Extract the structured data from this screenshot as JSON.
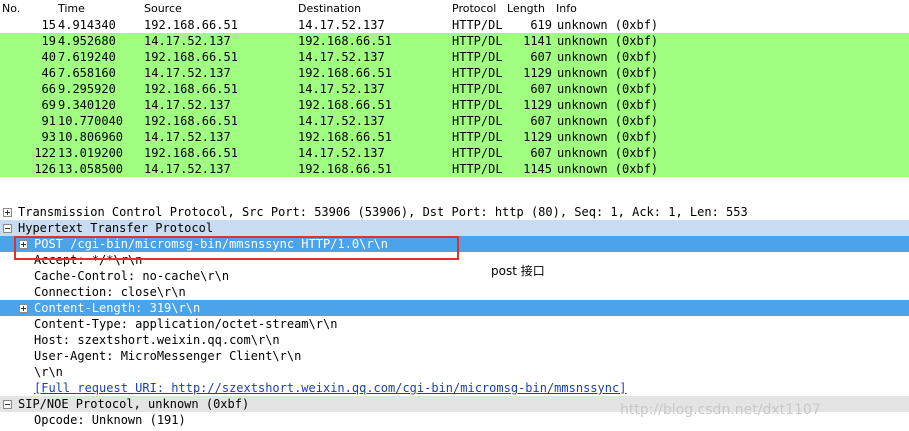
{
  "columns": {
    "no": "No.",
    "time": "Time",
    "source": "Source",
    "destination": "Destination",
    "protocol": "Protocol",
    "length": "Length",
    "info": "Info"
  },
  "packets": [
    {
      "no": "15",
      "time": "4.914340",
      "source": "192.168.66.51",
      "destination": "14.17.52.137",
      "protocol": "HTTP/DL",
      "length": "619",
      "info": "unknown (0xbf)",
      "color": "selected-white"
    },
    {
      "no": "19",
      "time": "4.952680",
      "source": "14.17.52.137",
      "destination": "192.168.66.51",
      "protocol": "HTTP/DL",
      "length": "1141",
      "info": "unknown (0xbf)",
      "color": "#a0ff80"
    },
    {
      "no": "40",
      "time": "7.619240",
      "source": "192.168.66.51",
      "destination": "14.17.52.137",
      "protocol": "HTTP/DL",
      "length": "607",
      "info": "unknown (0xbf)",
      "color": "#a0ff80"
    },
    {
      "no": "46",
      "time": "7.658160",
      "source": "14.17.52.137",
      "destination": "192.168.66.51",
      "protocol": "HTTP/DL",
      "length": "1129",
      "info": "unknown (0xbf)",
      "color": "#a0ff80"
    },
    {
      "no": "66",
      "time": "9.295920",
      "source": "192.168.66.51",
      "destination": "14.17.52.137",
      "protocol": "HTTP/DL",
      "length": "607",
      "info": "unknown (0xbf)",
      "color": "#a0ff80"
    },
    {
      "no": "69",
      "time": "9.340120",
      "source": "14.17.52.137",
      "destination": "192.168.66.51",
      "protocol": "HTTP/DL",
      "length": "1129",
      "info": "unknown (0xbf)",
      "color": "#a0ff80"
    },
    {
      "no": "91",
      "time": "10.770040",
      "source": "192.168.66.51",
      "destination": "14.17.52.137",
      "protocol": "HTTP/DL",
      "length": "607",
      "info": "unknown (0xbf)",
      "color": "#a0ff80"
    },
    {
      "no": "93",
      "time": "10.806960",
      "source": "14.17.52.137",
      "destination": "192.168.66.51",
      "protocol": "HTTP/DL",
      "length": "1129",
      "info": "unknown (0xbf)",
      "color": "#a0ff80"
    },
    {
      "no": "122",
      "time": "13.019200",
      "source": "192.168.66.51",
      "destination": "14.17.52.137",
      "protocol": "HTTP/DL",
      "length": "607",
      "info": "unknown (0xbf)",
      "color": "#a0ff80"
    },
    {
      "no": "126",
      "time": "13.058500",
      "source": "14.17.52.137",
      "destination": "192.168.66.51",
      "protocol": "HTTP/DL",
      "length": "1145",
      "info": "unknown (0xbf)",
      "color": "#a0ff80"
    }
  ],
  "details": {
    "tcp": "Transmission Control Protocol, Src Port: 53906 (53906), Dst Port: http (80), Seq: 1, Ack: 1, Len: 553",
    "http": "Hypertext Transfer Protocol",
    "post": "POST /cgi-bin/micromsg-bin/mmsnssync HTTP/1.0\\r\\n",
    "accept": "Accept: */*\\r\\n",
    "cache": "Cache-Control: no-cache\\r\\n",
    "conn": "Connection: close\\r\\n",
    "clen": "Content-Length: 319\\r\\n",
    "ctype": "Content-Type: application/octet-stream\\r\\n",
    "host": "Host: szextshort.weixin.qq.com\\r\\n",
    "ua": "User-Agent: MicroMessenger Client\\r\\n",
    "crlf": "\\r\\n",
    "fulluri": "[Full request URI: http://szextshort.weixin.qq.com/cgi-bin/micromsg-bin/mmsnssync]",
    "sip": "SIP/NOE Protocol, unknown (0xbf)",
    "opcode": "Opcode: Unknown (191)"
  },
  "annotation": {
    "note": "post 接口"
  },
  "watermark": "http://blog.csdn.net/dxt1107",
  "colors": {
    "green_row": "#a0ff80",
    "selected_blue": "#4ba3ea",
    "highlight_box": "#e03030",
    "link": "#1a3fb8"
  }
}
